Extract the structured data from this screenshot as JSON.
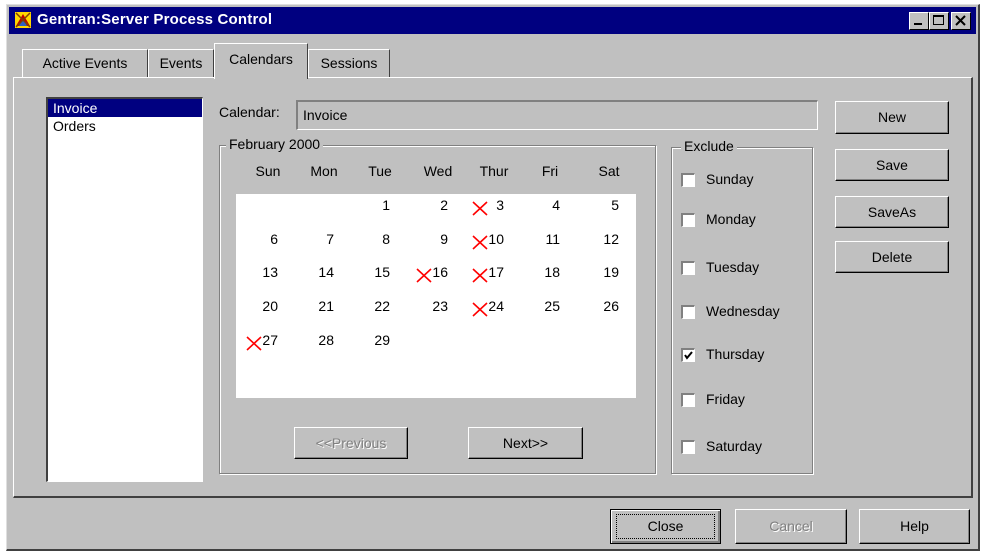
{
  "window": {
    "title": "Gentran:Server Process Control",
    "title_color": "#000080"
  },
  "tabs": [
    {
      "label": "Active Events"
    },
    {
      "label": "Events"
    },
    {
      "label": "Calendars",
      "active": true
    },
    {
      "label": "Sessions"
    }
  ],
  "calendar_list": {
    "items": [
      "Invoice",
      "Orders"
    ],
    "selected": "Invoice"
  },
  "calendar_field": {
    "label": "Calendar:",
    "value": "Invoice"
  },
  "month_group": {
    "label": "February 2000"
  },
  "weekdays": [
    "Sun",
    "Mon",
    "Tue",
    "Wed",
    "Thur",
    "Fri",
    "Sat"
  ],
  "days": [
    {
      "d": "1",
      "x": false
    },
    {
      "d": "2",
      "x": false
    },
    {
      "d": "3",
      "x": true
    },
    {
      "d": "4",
      "x": false
    },
    {
      "d": "5",
      "x": false
    },
    {
      "d": "6",
      "x": false
    },
    {
      "d": "7",
      "x": false
    },
    {
      "d": "8",
      "x": false
    },
    {
      "d": "9",
      "x": false
    },
    {
      "d": "10",
      "x": true
    },
    {
      "d": "11",
      "x": false
    },
    {
      "d": "12",
      "x": false
    },
    {
      "d": "13",
      "x": false
    },
    {
      "d": "14",
      "x": false
    },
    {
      "d": "15",
      "x": false
    },
    {
      "d": "16",
      "x": true
    },
    {
      "d": "17",
      "x": true
    },
    {
      "d": "18",
      "x": false
    },
    {
      "d": "19",
      "x": false
    },
    {
      "d": "20",
      "x": false
    },
    {
      "d": "21",
      "x": false
    },
    {
      "d": "22",
      "x": false
    },
    {
      "d": "23",
      "x": false
    },
    {
      "d": "24",
      "x": true
    },
    {
      "d": "25",
      "x": false
    },
    {
      "d": "26",
      "x": false
    },
    {
      "d": "27",
      "x": true
    },
    {
      "d": "28",
      "x": false
    },
    {
      "d": "29",
      "x": false
    }
  ],
  "first_weekday_index": 2,
  "nav": {
    "previous": "<<Previous",
    "next": "Next>>"
  },
  "exclude": {
    "label": "Exclude",
    "options": [
      {
        "label": "Sunday",
        "checked": false
      },
      {
        "label": "Monday",
        "checked": false
      },
      {
        "label": "Tuesday",
        "checked": false
      },
      {
        "label": "Wednesday",
        "checked": false
      },
      {
        "label": "Thursday",
        "checked": true
      },
      {
        "label": "Friday",
        "checked": false
      },
      {
        "label": "Saturday",
        "checked": false
      }
    ]
  },
  "side_buttons": {
    "new": "New",
    "save": "Save",
    "saveas": "SaveAs",
    "delete": "Delete"
  },
  "bottom_buttons": {
    "close": "Close",
    "cancel": "Cancel",
    "help": "Help"
  },
  "colors": {
    "x_mark": "#ff0000",
    "face": "#c0c0c0",
    "selection": "#000080"
  }
}
